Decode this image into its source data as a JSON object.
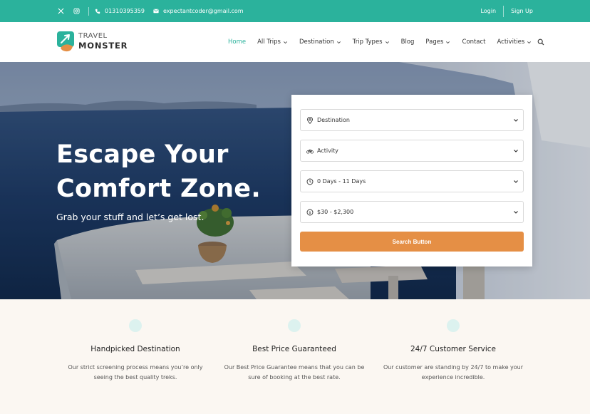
{
  "topbar": {
    "social": [
      {
        "icon": "x-twitter-icon"
      },
      {
        "icon": "instagram-icon"
      }
    ],
    "phone": "01310395359",
    "email": "expectantcoder@gmail.com",
    "login": "Login",
    "signup": "Sign Up",
    "bg_color": "#2bb29c"
  },
  "logo": {
    "line1": "TRAVEL",
    "line2": "MONSTER"
  },
  "nav": {
    "items": [
      {
        "label": "Home",
        "active": true,
        "dropdown": false
      },
      {
        "label": "All Trips",
        "active": false,
        "dropdown": true
      },
      {
        "label": "Destination",
        "active": false,
        "dropdown": true
      },
      {
        "label": "Trip Types",
        "active": false,
        "dropdown": true
      },
      {
        "label": "Blog",
        "active": false,
        "dropdown": false
      },
      {
        "label": "Pages",
        "active": false,
        "dropdown": true
      },
      {
        "label": "Contact",
        "active": false,
        "dropdown": false
      },
      {
        "label": "Activities",
        "active": false,
        "dropdown": true
      }
    ],
    "accent_color": "#2bb29c"
  },
  "hero": {
    "title_line1": "Escape Your",
    "title_line2": "Comfort Zone.",
    "subtitle": "Grab your stuff and let’s get lost."
  },
  "search": {
    "destination": "Destination",
    "activity": "Activity",
    "duration": "0 Days - 11 Days",
    "price": "$30 - $2,300",
    "button": "Search Button",
    "button_color": "#e58f45"
  },
  "features": [
    {
      "title": "Handpicked Destination",
      "desc": "Our strict screening process means you’re only seeing the best quality treks."
    },
    {
      "title": "Best Price Guaranteed",
      "desc": "Our Best Price Guarantee means that you can be sure of booking at the best rate."
    },
    {
      "title": "24/7 Customer Service",
      "desc": "Our customer are standing by 24/7 to make your experience incredible."
    }
  ]
}
